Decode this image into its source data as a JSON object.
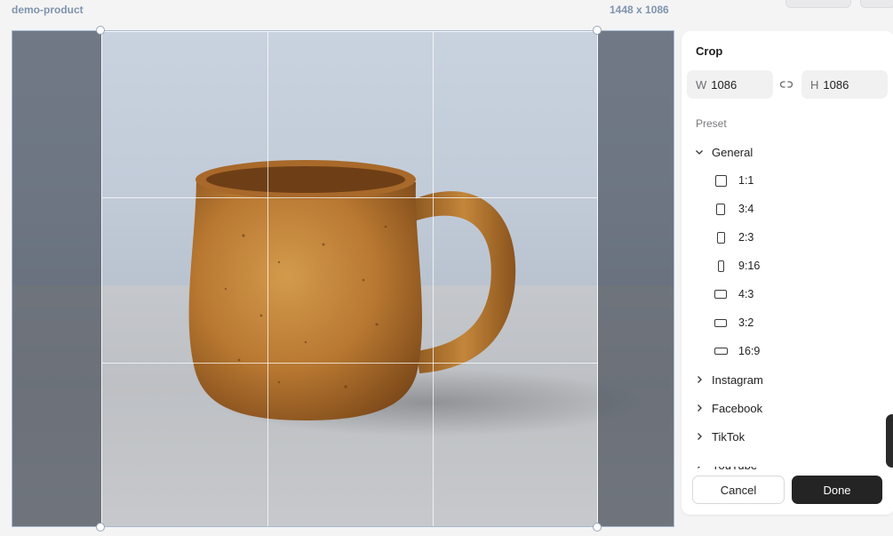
{
  "header": {
    "filename": "demo-product",
    "image_dimensions": "1448 x 1086"
  },
  "panel": {
    "title": "Crop",
    "width_label": "W",
    "width_value": "1086",
    "height_label": "H",
    "height_value": "1086",
    "link_icon": "link-icon",
    "preset_label": "Preset",
    "groups": [
      {
        "label": "General",
        "expanded": true,
        "presets": [
          {
            "label": "1:1",
            "ratio": 1.0
          },
          {
            "label": "3:4",
            "ratio": 0.75
          },
          {
            "label": "2:3",
            "ratio": 0.6667
          },
          {
            "label": "9:16",
            "ratio": 0.5625
          },
          {
            "label": "4:3",
            "ratio": 1.3333
          },
          {
            "label": "3:2",
            "ratio": 1.5
          },
          {
            "label": "16:9",
            "ratio": 1.7778
          }
        ]
      },
      {
        "label": "Instagram",
        "expanded": false
      },
      {
        "label": "Facebook",
        "expanded": false
      },
      {
        "label": "TikTok",
        "expanded": false
      },
      {
        "label": "YouTube",
        "expanded": false
      }
    ],
    "cancel_label": "Cancel",
    "done_label": "Done"
  },
  "colors": {
    "accent": "#7f93ad",
    "done_button": "#242424",
    "mug": "#b97a32"
  }
}
